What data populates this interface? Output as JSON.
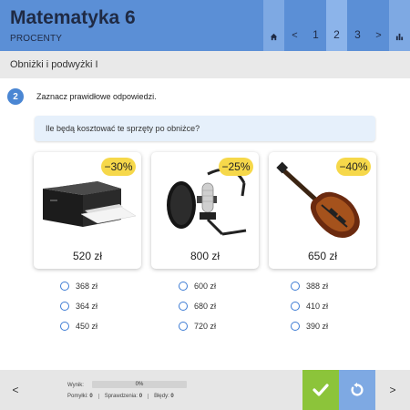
{
  "header": {
    "title": "Matematyka 6",
    "subtitle": "PROCENTY",
    "nav": {
      "home_icon": "home-icon",
      "prev": "<",
      "pages": [
        "1",
        "2",
        "3"
      ],
      "active_page": "2",
      "next": ">",
      "stats_icon": "bar-chart-icon"
    }
  },
  "section": {
    "title": "Obniżki i podwyżki I"
  },
  "task": {
    "number": "2",
    "instruction": "Zaznacz prawidłowe odpowiedzi.",
    "question": "Ile będą kosztować te sprzęty po obniżce?"
  },
  "products": [
    {
      "name": "printer",
      "discount": "−30%",
      "price": "520 zł",
      "options": [
        "368 zł",
        "364 zł",
        "450 zł"
      ]
    },
    {
      "name": "microphone",
      "discount": "−25%",
      "price": "800 zł",
      "options": [
        "600 zł",
        "680 zł",
        "720 zł"
      ]
    },
    {
      "name": "guitar",
      "discount": "−40%",
      "price": "650 zł",
      "options": [
        "388 zł",
        "410 zł",
        "390 zł"
      ]
    }
  ],
  "footer": {
    "prev": "<",
    "next": ">",
    "score_label": "Wynik:",
    "progress_text": "0%",
    "progress_value": 0,
    "mistakes_label": "Pomyłki:",
    "mistakes": "0",
    "checks_label": "Sprawdzenia:",
    "checks": "0",
    "errors_label": "Błędy:",
    "errors": "0",
    "check_icon": "checkmark-icon",
    "reset_icon": "reset-icon"
  },
  "colors": {
    "header": "#5b8fd6",
    "accent": "#4a86d3",
    "badge": "#f6d84a",
    "check": "#8cc43a",
    "reset": "#7ea9e3"
  }
}
